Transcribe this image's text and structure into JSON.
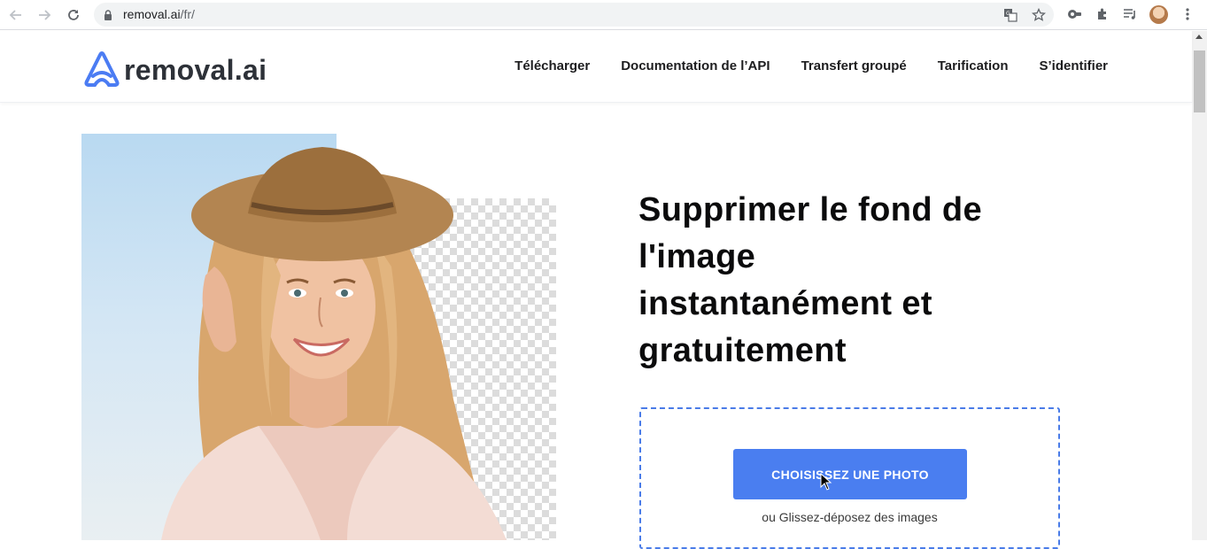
{
  "browser": {
    "url_host": "removal.ai",
    "url_path": "/fr/"
  },
  "header": {
    "logo_text": "removal.ai",
    "nav": [
      "Télécharger",
      "Documentation de l’API",
      "Transfert groupé",
      "Tarification",
      "S’identifier"
    ]
  },
  "hero": {
    "title_lines": [
      "Supprimer le fond de",
      "l'image",
      "instantanément et",
      "gratuitement"
    ],
    "upload_button": "CHOISISSEZ UNE PHOTO",
    "drop_hint": "ou Glissez-déposez des images"
  },
  "colors": {
    "accent": "#4a7ef0",
    "dropzone_border": "#4a7ce8",
    "logo_blue": "#4b7cf3",
    "text_dark": "#2d3138"
  },
  "icons": [
    "back-arrow-icon",
    "forward-arrow-icon",
    "reload-icon",
    "lock-icon",
    "translate-icon",
    "star-icon",
    "extension-icon",
    "puzzle-icon",
    "media-icon",
    "profile-avatar",
    "kebab-menu-icon"
  ]
}
